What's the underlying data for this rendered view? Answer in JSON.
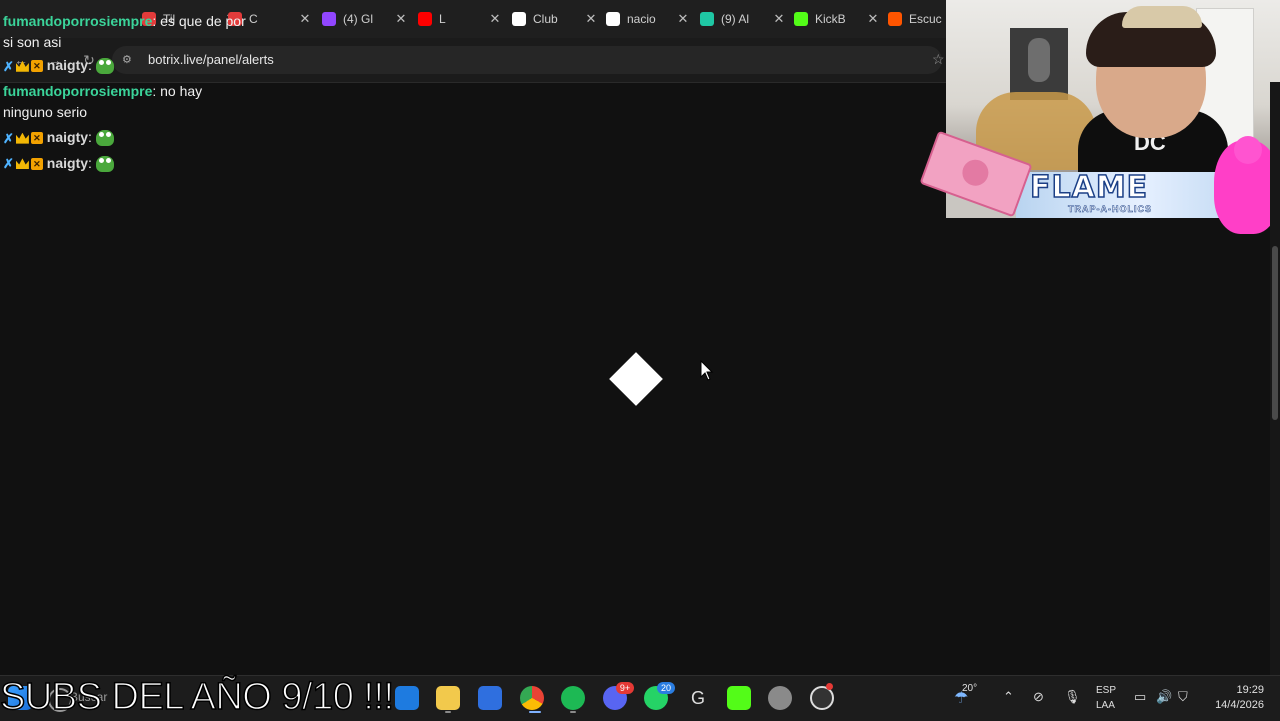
{
  "browser": {
    "tabs": [
      {
        "label": "Til",
        "favicon": "video-icon",
        "color": "#e23b3b"
      },
      {
        "label": "C",
        "favicon": "video-icon",
        "color": "#e23b3b"
      },
      {
        "label": "(4) Gl",
        "favicon": "twitch-icon",
        "color": "#9146ff"
      },
      {
        "label": "L",
        "favicon": "youtube-icon",
        "color": "#ff0000"
      },
      {
        "label": "Club",
        "favicon": "google-icon",
        "color": "#ffffff"
      },
      {
        "label": "nacio",
        "favicon": "google-icon",
        "color": "#ffffff"
      },
      {
        "label": "(9) Al",
        "favicon": "app-icon",
        "color": "#1fc7a4"
      },
      {
        "label": "KickB",
        "favicon": "kick-icon",
        "color": "#53fc18"
      },
      {
        "label": "Escuc",
        "favicon": "soundcloud-icon",
        "color": "#ff5500"
      }
    ],
    "url": "botrix.live/panel/alerts"
  },
  "chat": {
    "messages": [
      {
        "user": "fumandoporrosiempre",
        "text": ": es que de por si son asi"
      },
      {
        "user": "naigty",
        "text": ":"
      },
      {
        "user": "fumandoporrosiempre",
        "text": ": no hay ninguno serio"
      },
      {
        "user": "naigty",
        "text": ":"
      },
      {
        "user": "naigty",
        "text": ":"
      }
    ]
  },
  "stream": {
    "banner_title": "FLAME",
    "banner_subtitle": "TRAP-A-HOLICS",
    "shirt_text": "DC",
    "caption": "SUBS DEL AÑO 9/10 !!!"
  },
  "taskbar": {
    "search_placeholder": "Buscar",
    "discord_badge": "9+",
    "whatsapp_badge": "20",
    "weather": "20°",
    "lang_1": "ESP",
    "lang_2": "LAA",
    "time": "19:29",
    "date": "14/4/2026"
  }
}
